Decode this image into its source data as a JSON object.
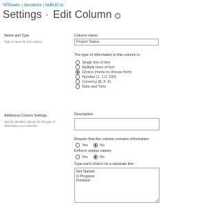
{
  "breadcrumb": [
    "SPGeeks",
    "devoworx",
    "deBUG.to"
  ],
  "title": {
    "parent": "Settings",
    "separator": "·",
    "current": "Edit Column",
    "info_glyph": "i"
  },
  "name_type": {
    "section_title": "Name and Type",
    "section_desc": "Type a name for this column.",
    "column_name_label": "Column name:",
    "column_name_value": "Project Status",
    "type_question": "The type of information in this column is:",
    "types": [
      {
        "label": "Single line of text",
        "selected": false
      },
      {
        "label": "Multiple lines of text",
        "selected": false
      },
      {
        "label": "Choice (menu to choose from)",
        "selected": true
      },
      {
        "label": "Number (1, 1.0, 100)",
        "selected": false
      },
      {
        "label": "Currency ($, ¥, €)",
        "selected": false
      },
      {
        "label": "Date and Time",
        "selected": false
      }
    ]
  },
  "additional": {
    "section_title": "Additional Column Settings",
    "section_desc": "Specify detailed options for the type of information you selected.",
    "description_label": "Description:",
    "description_value": "",
    "require_label": "Require that this column contains information:",
    "require_options": [
      {
        "label": "Yes",
        "selected": false
      },
      {
        "label": "No",
        "selected": true
      }
    ],
    "unique_label": "Enforce unique values:",
    "unique_options": [
      {
        "label": "Yes",
        "selected": false
      },
      {
        "label": "No",
        "selected": true
      }
    ],
    "choices_label": "Type each choice on a separate line:",
    "choices": [
      "Not Started",
      "In Progress",
      "Finished"
    ]
  }
}
